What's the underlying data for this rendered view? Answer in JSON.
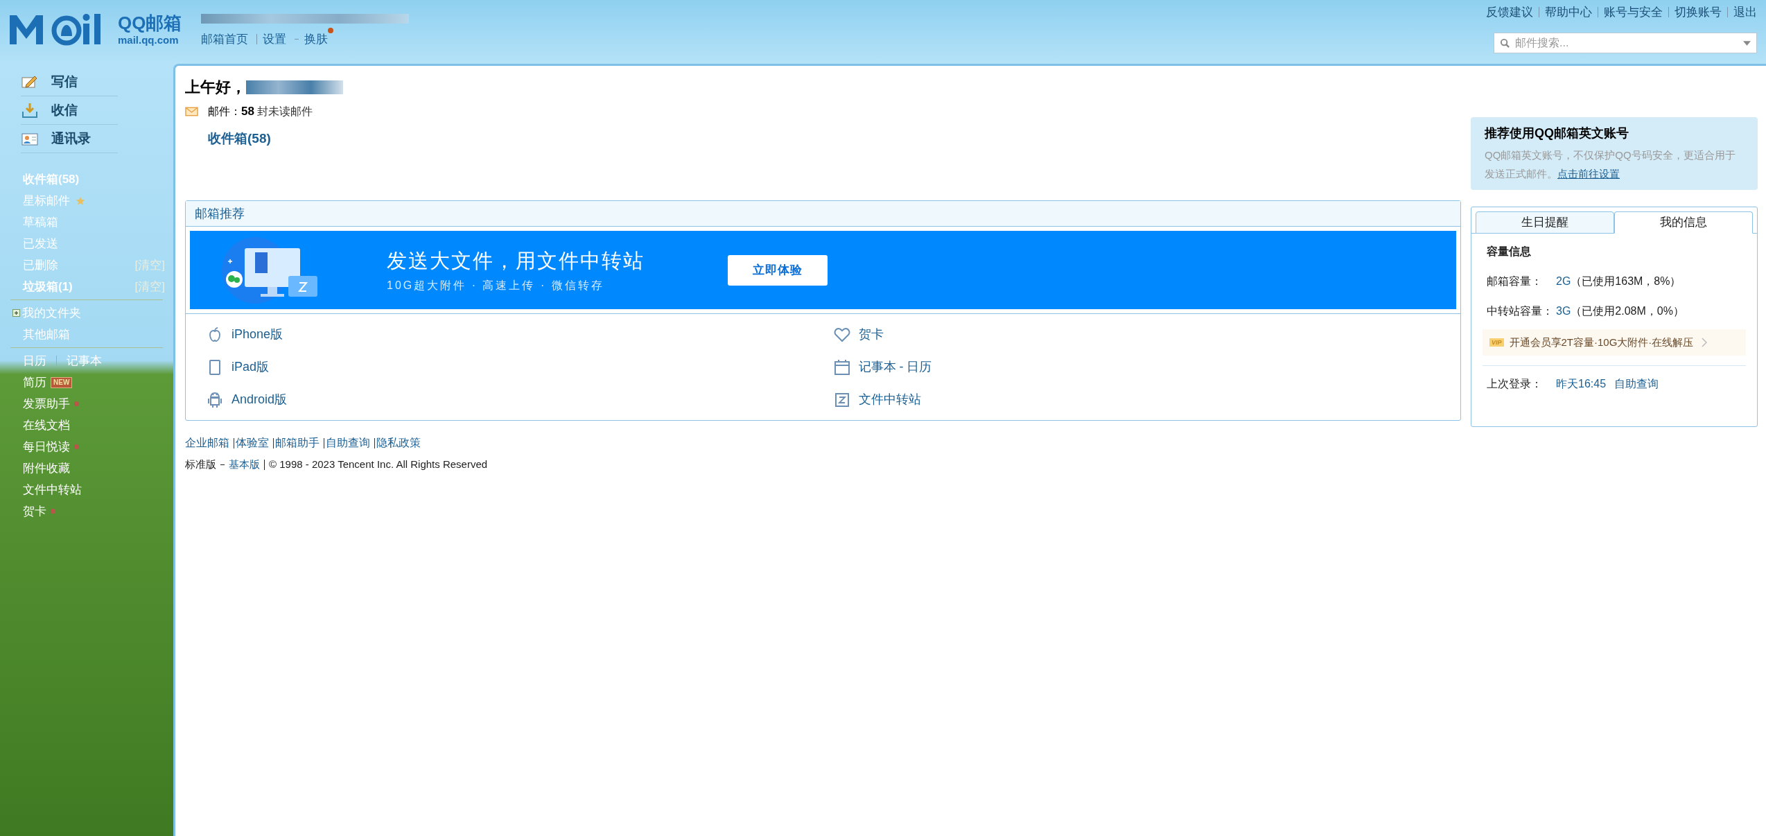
{
  "logo": {
    "brand": "QQ邮箱",
    "domain": "mail.qq.com"
  },
  "header": {
    "nav": [
      {
        "label": "邮箱首页",
        "dot": false
      },
      {
        "label": "设置",
        "dot": false
      },
      {
        "label": "换肤",
        "dot": true
      }
    ],
    "top_links": [
      "反馈建议",
      "帮助中心",
      "账号与安全",
      "切换账号",
      "退出"
    ],
    "search": {
      "placeholder": "邮件搜索..."
    }
  },
  "sidebar": {
    "actions": [
      {
        "label": "写信",
        "kind": "compose"
      },
      {
        "label": "收信",
        "kind": "receive"
      },
      {
        "label": "通讯录",
        "kind": "contacts"
      }
    ],
    "folders": [
      {
        "label": "收件箱(58)",
        "bold": true,
        "starred": false
      },
      {
        "label": "星标邮件",
        "bold": false,
        "starred": true
      },
      {
        "label": "草稿箱",
        "bold": false,
        "starred": false
      },
      {
        "label": "已发送",
        "bold": false,
        "starred": false
      },
      {
        "label": "已删除",
        "bold": false,
        "starred": false,
        "action": "[清空]"
      },
      {
        "label": "垃圾箱(1)",
        "bold": true,
        "starred": false,
        "action": "[清空]"
      }
    ],
    "my_folders": {
      "label": "我的文件夹",
      "expanded": false
    },
    "other": "其他邮箱",
    "tools": [
      {
        "label": "日历",
        "dot": false,
        "sibling": "记事本"
      },
      {
        "label": "简历",
        "dot": false,
        "badge": "NEW"
      },
      {
        "label": "发票助手",
        "dot": true
      },
      {
        "label": "在线文档",
        "dot": false
      },
      {
        "label": "每日悦读",
        "dot": true
      },
      {
        "label": "附件收藏",
        "dot": false
      },
      {
        "label": "文件中转站",
        "dot": false
      },
      {
        "label": "贺卡",
        "dot": true
      }
    ]
  },
  "welcome": {
    "greeting": "上午好，",
    "mail_label": "邮件：",
    "unread_count": "58",
    "unread_text": "封未读邮件",
    "inbox_link": "收件箱(58)"
  },
  "recommend": {
    "title": "邮箱推荐",
    "banner": {
      "headline": "发送大文件，用文件中转站",
      "subline": "10G超大附件 · 高速上传 · 微信转存",
      "button": "立即体验"
    },
    "links": [
      {
        "label": "iPhone版",
        "kind": "apple"
      },
      {
        "label": "贺卡",
        "kind": "heart"
      },
      {
        "label": "iPad版",
        "kind": "tablet"
      },
      {
        "label": "记事本 - 日历",
        "kind": "calendar"
      },
      {
        "label": "Android版",
        "kind": "android"
      },
      {
        "label": "文件中转站",
        "kind": "transfer"
      }
    ]
  },
  "footer": {
    "links": [
      "企业邮箱",
      "体验室",
      "邮箱助手",
      "自助查询",
      "隐私政策"
    ],
    "edition": "标准版",
    "basic": "基本版",
    "copyright": "© 1998 - 2023 Tencent Inc. All Rights Reserved"
  },
  "promo": {
    "title": "推荐使用QQ邮箱英文账号",
    "text": "QQ邮箱英文账号，不仅保护QQ号码安全，更适合用于发送正式邮件。",
    "link": "点击前往设置"
  },
  "info_panel": {
    "tabs": [
      {
        "label": "生日提醒",
        "selected": false
      },
      {
        "label": "我的信息",
        "selected": true
      }
    ],
    "heading": "容量信息",
    "rows": [
      {
        "label": "邮箱容量：",
        "value": "2G",
        "detail": "（已使用163M，8%）"
      },
      {
        "label": "中转站容量：",
        "value": "3G",
        "detail": "（已使用2.08M，0%）"
      }
    ],
    "vip": {
      "badge": "VIP",
      "text": "开通会员享2T容量·10G大附件·在线解压"
    },
    "last_login": {
      "label": "上次登录：",
      "time": "昨天16:45",
      "link": "自助查询"
    }
  }
}
